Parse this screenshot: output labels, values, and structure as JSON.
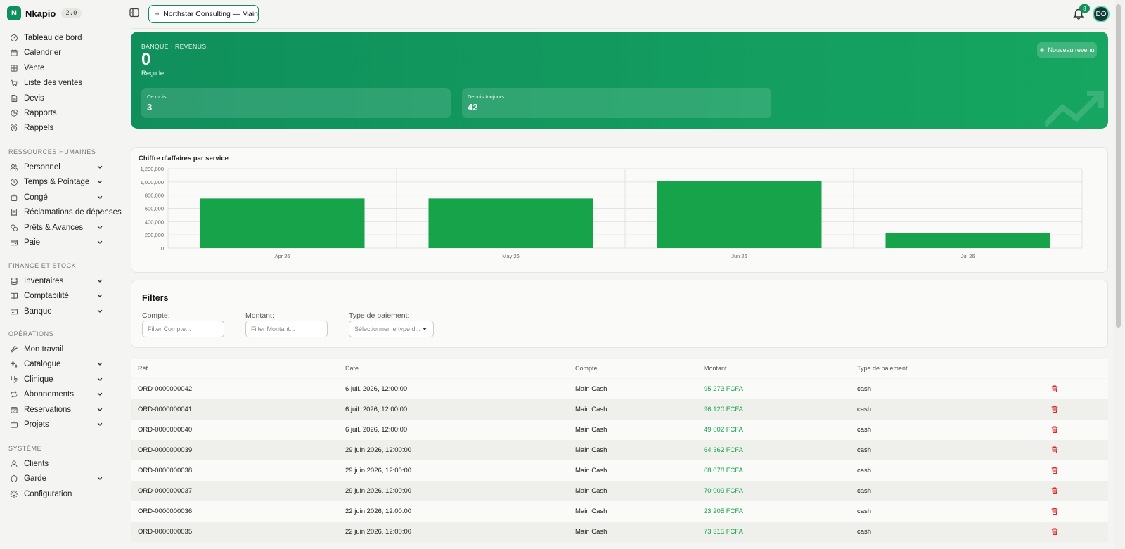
{
  "app": {
    "name": "Nkapio",
    "version": "2.0"
  },
  "sidebar": {
    "main": [
      {
        "label": "Tableau de bord",
        "icon": "dashboard-icon"
      },
      {
        "label": "Calendrier",
        "icon": "calendar-icon"
      },
      {
        "label": "Vente",
        "icon": "grid-icon"
      },
      {
        "label": "Liste des ventes",
        "icon": "cart-icon"
      },
      {
        "label": "Devis",
        "icon": "document-icon"
      },
      {
        "label": "Rapports",
        "icon": "pie-chart-icon"
      },
      {
        "label": "Rappels",
        "icon": "alarm-icon"
      }
    ],
    "rh_title": "RESSOURCES HUMAINES",
    "rh": [
      {
        "label": "Personnel",
        "icon": "users-icon"
      },
      {
        "label": "Temps & Pointage",
        "icon": "clock-icon"
      },
      {
        "label": "Congé",
        "icon": "luggage-icon"
      },
      {
        "label": "Réclamations de dépenses",
        "icon": "receipt-icon"
      },
      {
        "label": "Prêts & Avances",
        "icon": "coins-icon"
      },
      {
        "label": "Paie",
        "icon": "wallet-icon"
      }
    ],
    "fin_title": "FINANCE ET STOCK",
    "fin": [
      {
        "label": "Inventaires",
        "icon": "database-icon"
      },
      {
        "label": "Comptabilité",
        "icon": "book-icon"
      },
      {
        "label": "Banque",
        "icon": "bank-icon"
      }
    ],
    "ops_title": "OPÉRATIONS",
    "ops": [
      {
        "label": "Mon travail",
        "icon": "wrench-icon"
      },
      {
        "label": "Catalogue",
        "icon": "sparkle-icon"
      },
      {
        "label": "Clinique",
        "icon": "stethoscope-icon"
      },
      {
        "label": "Abonnements",
        "icon": "repeat-icon"
      },
      {
        "label": "Réservations",
        "icon": "calendar-check-icon"
      },
      {
        "label": "Projets",
        "icon": "briefcase-icon"
      }
    ],
    "sys_title": "SYSTÈME",
    "sys": [
      {
        "label": "Clients",
        "icon": "user-icon"
      },
      {
        "label": "Garde",
        "icon": "shield-icon"
      },
      {
        "label": "Configuration",
        "icon": "gear-icon"
      }
    ]
  },
  "topbar": {
    "company": "Northstar Consulting — Main",
    "notifications": "8",
    "avatar": "DO"
  },
  "hero": {
    "eyebrow": "BANQUE · REVENUS",
    "value": "0",
    "sub": "Reçu le",
    "new_button": "Nouveau revenu",
    "stats": [
      {
        "label": "Ce mois",
        "value": "3"
      },
      {
        "label": "Depuis toujours",
        "value": "42"
      }
    ],
    "colors": {
      "from": "#0f8f5c",
      "to": "#16a661"
    }
  },
  "chart_data": {
    "type": "bar",
    "title": "Chiffre d'affaires par service",
    "categories": [
      "Apr 26",
      "May 26",
      "Jun 26",
      "Jul 26"
    ],
    "values": [
      750000,
      750000,
      1010000,
      230000
    ],
    "yticks": [
      "0",
      "200,000",
      "400,000",
      "600,000",
      "800,000",
      "1,000,000",
      "1,200,000"
    ],
    "ylim": [
      0,
      1200000
    ],
    "bar_color": "#16a34a",
    "grid": true
  },
  "filters": {
    "title": "Filters",
    "fields": [
      {
        "label": "Compte:",
        "placeholder": "Filter Compte..."
      },
      {
        "label": "Montant:",
        "placeholder": "Filter Montant..."
      },
      {
        "label": "Type de paiement:",
        "placeholder": "Sélectionner le type d..."
      }
    ]
  },
  "table": {
    "columns": [
      "Réf",
      "Date",
      "Compte",
      "Montant",
      "Type de paiement"
    ],
    "rows": [
      {
        "ref": "ORD-0000000042",
        "date": "6 juil. 2026, 12:00:00",
        "account": "Main Cash",
        "amount": "95 273 FCFA",
        "type": "cash"
      },
      {
        "ref": "ORD-0000000041",
        "date": "6 juil. 2026, 12:00:00",
        "account": "Main Cash",
        "amount": "96 120 FCFA",
        "type": "cash"
      },
      {
        "ref": "ORD-0000000040",
        "date": "6 juil. 2026, 12:00:00",
        "account": "Main Cash",
        "amount": "49 002 FCFA",
        "type": "cash"
      },
      {
        "ref": "ORD-0000000039",
        "date": "29 juin 2026, 12:00:00",
        "account": "Main Cash",
        "amount": "64 362 FCFA",
        "type": "cash"
      },
      {
        "ref": "ORD-0000000038",
        "date": "29 juin 2026, 12:00:00",
        "account": "Main Cash",
        "amount": "68 078 FCFA",
        "type": "cash"
      },
      {
        "ref": "ORD-0000000037",
        "date": "29 juin 2026, 12:00:00",
        "account": "Main Cash",
        "amount": "70 009 FCFA",
        "type": "cash"
      },
      {
        "ref": "ORD-0000000036",
        "date": "22 juin 2026, 12:00:00",
        "account": "Main Cash",
        "amount": "23 205 FCFA",
        "type": "cash"
      },
      {
        "ref": "ORD-0000000035",
        "date": "22 juin 2026, 12:00:00",
        "account": "Main Cash",
        "amount": "73 315 FCFA",
        "type": "cash"
      }
    ]
  }
}
